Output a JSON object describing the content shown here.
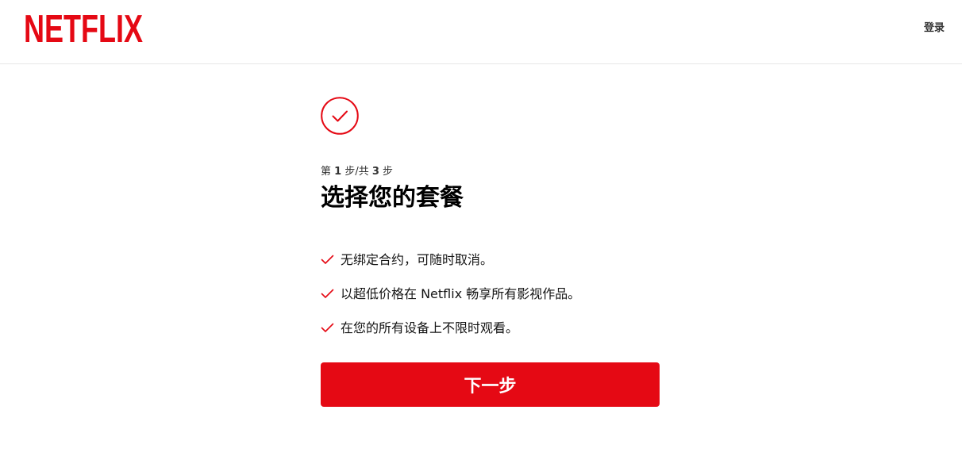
{
  "colors": {
    "brand_red": "#e50914",
    "header_border": "#e6e6e6",
    "text": "#000000"
  },
  "header": {
    "logo_text": "NETFLIX",
    "login_label": "登录"
  },
  "main": {
    "icon": "check-circle-icon",
    "step": {
      "prefix": "第 ",
      "current": "1",
      "middle": " 步/共 ",
      "total": "3",
      "suffix": " 步"
    },
    "title": "选择您的套餐",
    "benefits": [
      {
        "icon": "check-icon",
        "text": "无绑定合约，可随时取消。"
      },
      {
        "icon": "check-icon",
        "text": "以超低价格在 Netflix 畅享所有影视作品。"
      },
      {
        "icon": "check-icon",
        "text": "在您的所有设备上不限时观看。"
      }
    ],
    "next_button_label": "下一步"
  }
}
